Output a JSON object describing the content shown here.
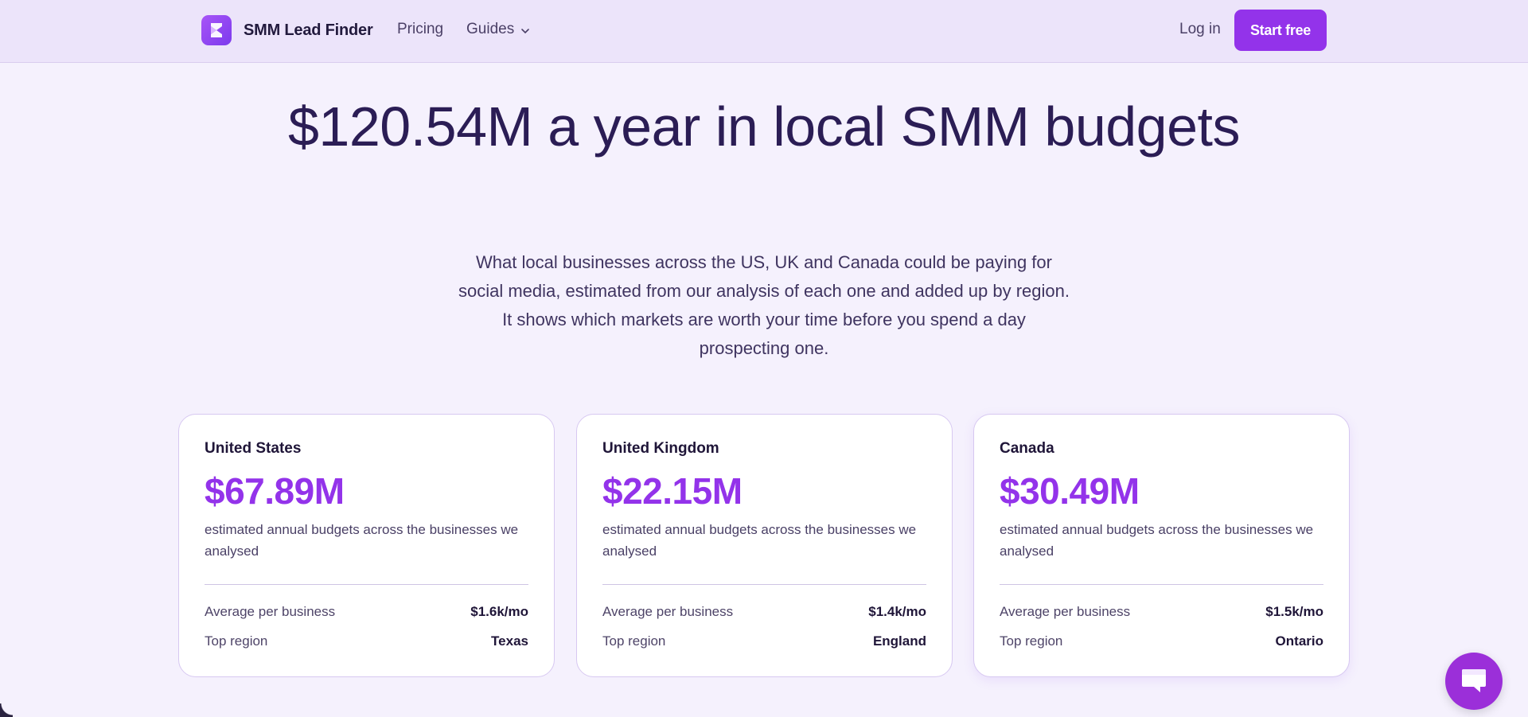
{
  "nav": {
    "brand_name": "SMM Lead Finder",
    "pricing": "Pricing",
    "guides": "Guides",
    "login": "Log in",
    "cta": "Start free"
  },
  "hero": {
    "title": "$120.54M a year in local SMM budgets",
    "subtitle": "What local businesses across the US, UK and Canada could be paying for social media, estimated from our analysis of each one and added up by region. It shows which markets are worth your time before you spend a day prospecting one."
  },
  "cards": [
    {
      "country": "United States",
      "amount": "$67.89M",
      "desc": "estimated annual budgets across the businesses we analysed",
      "avg_label": "Average per business",
      "avg_value": "$1.6k/mo",
      "region_label": "Top region",
      "region_value": "Texas"
    },
    {
      "country": "United Kingdom",
      "amount": "$22.15M",
      "desc": "estimated annual budgets across the businesses we analysed",
      "avg_label": "Average per business",
      "avg_value": "$1.4k/mo",
      "region_label": "Top region",
      "region_value": "England"
    },
    {
      "country": "Canada",
      "amount": "$30.49M",
      "desc": "estimated annual budgets across the businesses we analysed",
      "avg_label": "Average per business",
      "avg_value": "$1.5k/mo",
      "region_label": "Top region",
      "region_value": "Ontario"
    }
  ],
  "colors": {
    "accent": "#9333ea",
    "nav_bg": "#ece4fa",
    "page_bg": "#f5f1fd",
    "heading": "#2b1d55"
  },
  "icons": {
    "logo": "brand-logo-icon",
    "guides_dropdown": "chevron-down-icon",
    "chat": "chat-bubble-icon"
  }
}
